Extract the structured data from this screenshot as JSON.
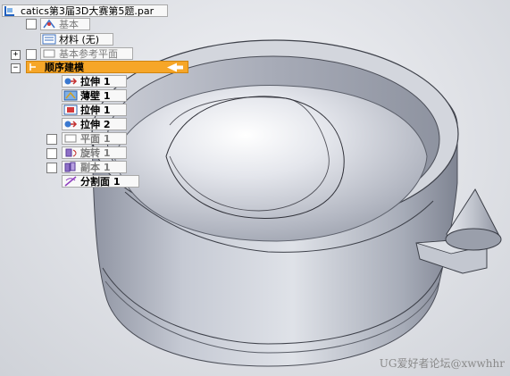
{
  "tree": {
    "root": "catics第3届3D大赛第5题.par",
    "items": [
      {
        "label": "基本",
        "dim": true
      },
      {
        "label": "材料 (无)"
      },
      {
        "label": "基本参考平面",
        "dim": true
      },
      {
        "label": "顺序建模"
      },
      {
        "label": "拉伸 1"
      },
      {
        "label": "薄壁 1"
      },
      {
        "label": "拉伸 1"
      },
      {
        "label": "拉伸 2"
      },
      {
        "label": "平面 1",
        "dim": true
      },
      {
        "label": "旋转 1",
        "dim": true
      },
      {
        "label": "副本 1",
        "dim": true
      },
      {
        "label": "分割面 1"
      }
    ],
    "expand_plus": "+",
    "expand_minus": "−"
  },
  "watermark": "UG爱好者论坛@xwwhhr",
  "colors": {
    "highlight": "#f6a628",
    "model": "#b9bec9"
  }
}
